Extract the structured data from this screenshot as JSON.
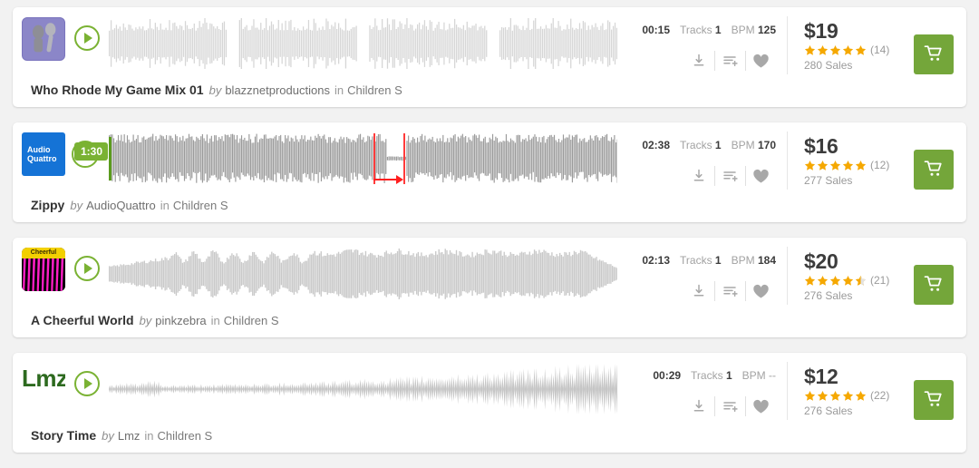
{
  "tracks": [
    {
      "title": "Who Rhode My Game Mix 01",
      "by_label": "by",
      "author": "blazznetproductions",
      "in_label": "in",
      "category": "Children S",
      "duration": "00:15",
      "tracks_label": "Tracks",
      "tracks_value": "1",
      "bpm_label": "BPM",
      "bpm_value": "125",
      "price": "$19",
      "rating": 5,
      "rating_count": "(14)",
      "sales": "280 Sales",
      "thumb_style": "purple-figures",
      "thumb_text": "",
      "wave_style": "light-segments",
      "player_state": "play"
    },
    {
      "title": "Zippy",
      "by_label": "by",
      "author": "AudioQuattro",
      "in_label": "in",
      "category": "Children S",
      "duration": "02:38",
      "tracks_label": "Tracks",
      "tracks_value": "1",
      "bpm_label": "BPM",
      "bpm_value": "170",
      "price": "$16",
      "rating": 5,
      "rating_count": "(12)",
      "sales": "277 Sales",
      "thumb_style": "blue-audioquattro",
      "thumb_text": "Audio Quattro",
      "wave_style": "dark-dense",
      "player_state": "playing",
      "play_time": "1:30",
      "annotation": {
        "type": "range-arrow",
        "color": "#ff1f1f"
      }
    },
    {
      "title": "A Cheerful World",
      "by_label": "by",
      "author": "pinkzebra",
      "in_label": "in",
      "category": "Children S",
      "duration": "02:13",
      "tracks_label": "Tracks",
      "tracks_value": "1",
      "bpm_label": "BPM",
      "bpm_value": "184",
      "price": "$20",
      "rating": 4.5,
      "rating_count": "(21)",
      "sales": "276 Sales",
      "thumb_style": "zebra",
      "thumb_text": "Cheerful",
      "wave_style": "light-broad",
      "player_state": "play"
    },
    {
      "title": "Story Time",
      "by_label": "by",
      "author": "Lmz",
      "in_label": "in",
      "category": "Children S",
      "duration": "00:29",
      "tracks_label": "Tracks",
      "tracks_value": "1",
      "bpm_label": "BPM",
      "bpm_value": "--",
      "bpm_dim": true,
      "price": "$12",
      "rating": 5,
      "rating_count": "(22)",
      "sales": "276 Sales",
      "thumb_style": "lmz",
      "thumb_text": "Lmz",
      "wave_style": "spiky-crescendo",
      "player_state": "play"
    }
  ],
  "icons": {
    "download": "download-icon",
    "add_to_playlist": "add-to-playlist-icon",
    "favorite": "heart-icon",
    "cart": "cart-icon",
    "play": "play-icon"
  },
  "colors": {
    "accent_green": "#7ab233",
    "cart_green": "#74a63a",
    "star_gold": "#f5a800",
    "annotation_red": "#ff1f1f",
    "page_bg": "#f2f2f2",
    "card_bg": "#ffffff"
  }
}
